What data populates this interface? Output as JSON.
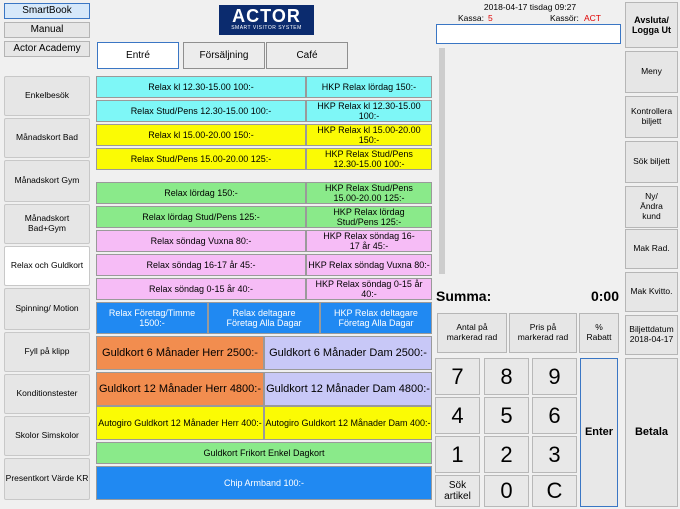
{
  "sidebar": {
    "top_items": [
      "SmartBook",
      "Manual",
      "Actor Academy"
    ],
    "items": [
      "Enkelbesök",
      "Månadskort Bad",
      "Månadskort Gym",
      "Månadskort Bad+Gym",
      "Relax och Guldkort",
      "Spinning/ Motion",
      "Fyll på klipp",
      "Konditionstester",
      "Skolor Simskolor",
      "Presentkort Värde KR"
    ]
  },
  "logo": {
    "name": "ACTOR",
    "tagline": "SMART VISITOR SYSTEM"
  },
  "tabs": [
    "Entré",
    "Försäljning",
    "Café"
  ],
  "products": {
    "p1": "Relax kl 12.30-15.00 100:-",
    "p2": "HKP Relax lördag 150:-",
    "p3": "Relax Stud/Pens 12.30-15.00 100:-",
    "p4": "HKP Relax kl 12.30-15.00 100:-",
    "p5": "Relax kl 15.00-20.00 150:-",
    "p6": "HKP Relax kl 15.00-20.00 150:-",
    "p7": "Relax Stud/Pens 15.00-20.00 125:-",
    "p8": "HKP Relax Stud/Pens 12.30-15.00 100:-",
    "p9": "Relax lördag 150:-",
    "p10": "HKP Relax Stud/Pens 15.00-20.00 125:-",
    "p11": "Relax lördag Stud/Pens 125:-",
    "p12": "HKP Relax lördag Stud/Pens 125:-",
    "p13": "Relax söndag Vuxna 80:-",
    "p14": "HKP Relax söndag 16-17 år 45:-",
    "p15": "Relax söndag 16-17 år 45:-",
    "p16": "HKP Relax söndag Vuxna 80:-",
    "p17": "Relax söndag 0-15 år 40:-",
    "p18": "HKP Relax söndag 0-15 år 40:-",
    "p19": "Relax Företag/Timme 1500:-",
    "p20": "Relax deltagare Företag Alla Dagar",
    "p21": "HKP Relax deltagare Företag Alla Dagar",
    "p22": "Guldkort 6 Månader Herr 2500:-",
    "p23": "Guldkort 6 Månader Dam 2500:-",
    "p24": "Guldkort 12 Månader Herr 4800:-",
    "p25": "Guldkort 12 Månader Dam 4800:-",
    "p26": "Autogiro Guldkort 12 Månader Herr 400:-",
    "p27": "Autogiro Guldkort 12 Månader Dam 400:-",
    "p28": "Guldkort Frikort Enkel Dagkort",
    "p29": "Chip Armband 100:-"
  },
  "header": {
    "datetime": "2018-04-17 tisdag 09:27",
    "kassa_label": "Kassa:",
    "kassa_value": "5",
    "kassor_label": "Kassör:",
    "kassor_value": "ACT"
  },
  "receipt_input": {
    "value": ""
  },
  "total": {
    "label": "Summa:",
    "value": "0:00"
  },
  "actions": {
    "antal": "Antal på markerad rad",
    "pris": "Pris på markerad rad",
    "rabatt": "% Rabatt"
  },
  "keypad": {
    "k7": "7",
    "k8": "8",
    "k9": "9",
    "k4": "4",
    "k5": "5",
    "k6": "6",
    "k1": "1",
    "k2": "2",
    "k3": "3",
    "sok": "Sök artikel",
    "k0": "0",
    "c": "C",
    "enter": "Enter"
  },
  "right_panel": {
    "avsluta": "Avsluta/ Logga Ut",
    "meny": "Meny",
    "kontrollera": "Kontrollera biljett",
    "sok": "Sök biljett",
    "ny_andra": "Ny/Ändra kund",
    "mak_rad": "Mak Rad.",
    "mak_kvitto": "Mak Kvitto.",
    "biljettdatum_label": "Biljettdatum",
    "biljettdatum": "2018-04-17",
    "betala": "Betala"
  },
  "colors": {
    "cyan": "#7ef7f7",
    "yellow": "#fbfb04",
    "green": "#8aea8a",
    "pink": "#f6bcf6",
    "blue": "#2089f2",
    "orange": "#f28d4f",
    "lavender": "#c8c8f7",
    "logo_bg": "#0b2b6e",
    "red_value": "#e00000"
  }
}
